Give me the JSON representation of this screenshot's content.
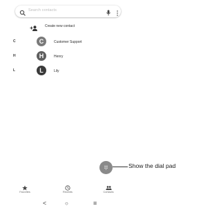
{
  "search": {
    "placeholder": "Search contacts"
  },
  "create_contact": {
    "label": "Create new contact"
  },
  "contacts": [
    {
      "section": "C",
      "initial": "C",
      "name": "Customer Support",
      "avatar_color": "#7a7a7a"
    },
    {
      "section": "H",
      "initial": "H",
      "name": "Henry",
      "avatar_color": "#5f5f5f"
    },
    {
      "section": "L",
      "initial": "L",
      "name": "Lily",
      "avatar_color": "#3a3a3a"
    }
  ],
  "fab": {
    "icon": "dialpad-icon"
  },
  "callout": {
    "text": "Show the dial pad"
  },
  "tabs": [
    {
      "label": "Favorites",
      "icon": "star-icon"
    },
    {
      "label": "Recents",
      "icon": "clock-icon"
    },
    {
      "label": "Contacts",
      "icon": "people-icon"
    }
  ],
  "nav": {
    "back": "<",
    "home": "○",
    "recents": "≡"
  }
}
